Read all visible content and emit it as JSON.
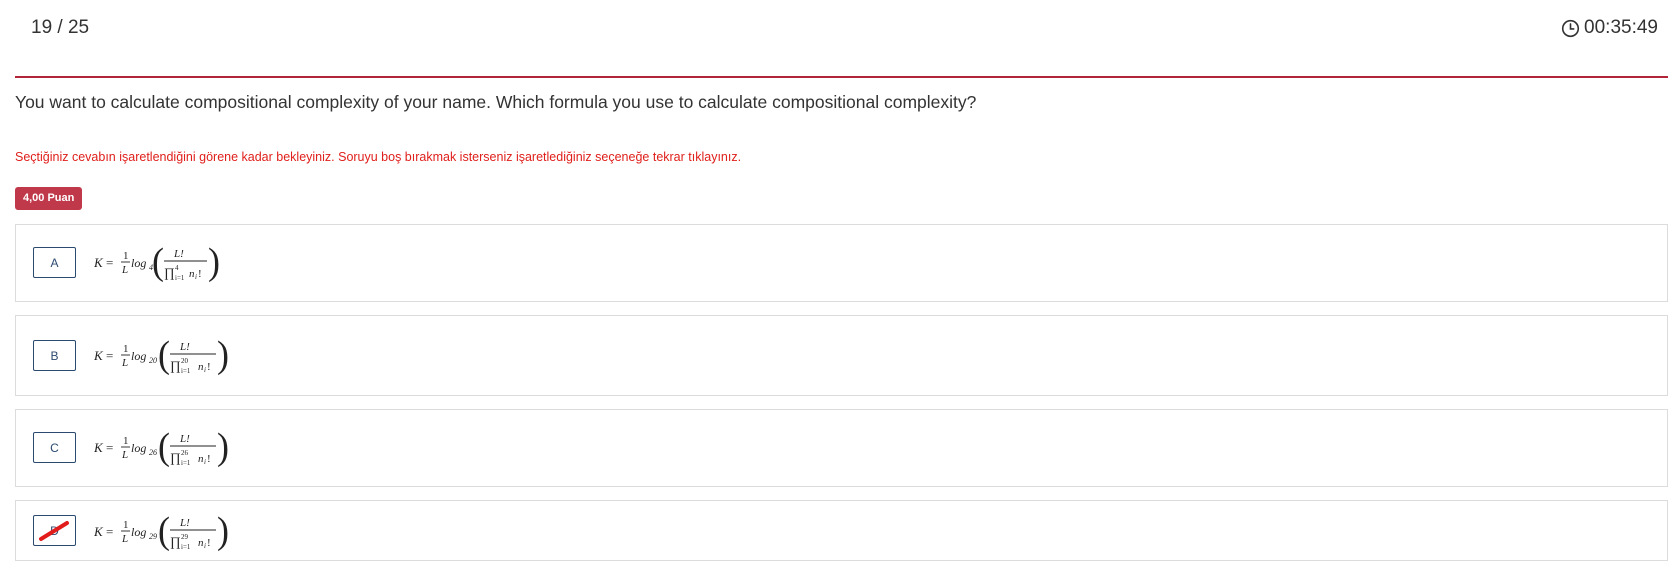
{
  "header": {
    "counter": "19 / 25",
    "timer": "00:35:49"
  },
  "question": {
    "text": "You want to calculate compositional complexity of your name. Which formula you use to calculate compositional complexity?",
    "warning": "Seçtiğiniz cevabın işaretlendiğini görene kadar bekleyiniz. Soruyu boş bırakmak isterseniz işaretlediğiniz seçeneğe tekrar tıklayınız.",
    "points": "4,00 Puan"
  },
  "options": [
    {
      "letter": "A",
      "K": "K",
      "eq": "=",
      "one": "1",
      "L": "L",
      "log": "log",
      "base": "4",
      "num": "L!",
      "prod": "∏",
      "upper": "4",
      "lower": "i=1",
      "ni": "n",
      "nisub": "i",
      "excl": "!",
      "lp": "(",
      "rp": ")",
      "crossed": false
    },
    {
      "letter": "B",
      "K": "K",
      "eq": "=",
      "one": "1",
      "L": "L",
      "log": "log",
      "base": "20",
      "num": "L!",
      "prod": "∏",
      "upper": "20",
      "lower": "i=1",
      "ni": "n",
      "nisub": "i",
      "excl": "!",
      "lp": "(",
      "rp": ")",
      "crossed": false
    },
    {
      "letter": "C",
      "K": "K",
      "eq": "=",
      "one": "1",
      "L": "L",
      "log": "log",
      "base": "26",
      "num": "L!",
      "prod": "∏",
      "upper": "26",
      "lower": "i=1",
      "ni": "n",
      "nisub": "i",
      "excl": "!",
      "lp": "(",
      "rp": ")",
      "crossed": false
    },
    {
      "letter": "D",
      "K": "K",
      "eq": "=",
      "one": "1",
      "L": "L",
      "log": "log",
      "base": "29",
      "num": "L!",
      "prod": "∏",
      "upper": "29",
      "lower": "i=1",
      "ni": "n",
      "nisub": "i",
      "excl": "!",
      "lp": "(",
      "rp": ")",
      "crossed": true
    }
  ],
  "colors": {
    "accent": "#b22437",
    "warning": "#e0201c",
    "badge": "#c0394b",
    "option_border": "#2b4a6f",
    "strike": "#e21b1b"
  },
  "icons": {
    "timer": "clock-icon",
    "crossed": "strikethrough-mark"
  }
}
